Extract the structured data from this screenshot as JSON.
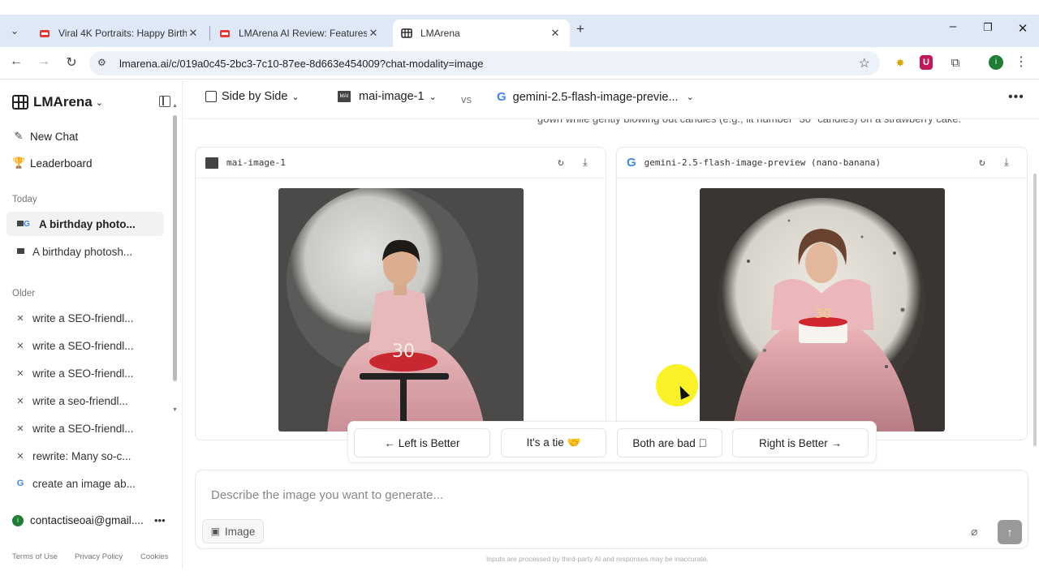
{
  "browser": {
    "tabs": [
      {
        "title": "Viral 4K Portraits: Happy Birthd",
        "favicon_color": "#e53935"
      },
      {
        "title": "LMArena AI Review: Features, P",
        "favicon_color": "#e53935"
      },
      {
        "title": "LMArena",
        "favicon_color": "#222222"
      }
    ],
    "tab_close": "✕",
    "new_tab": "+",
    "url": "lmarena.ai/c/019a0c45-2bc3-7c10-87ee-8d663e454009?chat-modality=image",
    "profile_initial": "i"
  },
  "sidebar": {
    "brand": "LMArena",
    "nav": [
      {
        "label": "New Chat",
        "icon": "edit-icon"
      },
      {
        "label": "Leaderboard",
        "icon": "trophy-icon"
      }
    ],
    "today_label": "Today",
    "today": [
      {
        "label": "A birthday photo...",
        "icon": "model-pair-icon",
        "active": true
      },
      {
        "label": "A birthday photosh...",
        "icon": "mai-icon",
        "active": false
      }
    ],
    "older_label": "Older",
    "older": [
      {
        "label": "write a SEO-friendl...",
        "icon": "x-icon"
      },
      {
        "label": "write a SEO-friendl...",
        "icon": "x-icon"
      },
      {
        "label": "write a SEO-friendl...",
        "icon": "x-icon"
      },
      {
        "label": "write a seo-friendl...",
        "icon": "x-icon"
      },
      {
        "label": "write a SEO-friendl...",
        "icon": "x-icon"
      },
      {
        "label": "rewrite: Many so-c...",
        "icon": "x-icon"
      },
      {
        "label": "create an image ab...",
        "icon": "google-icon"
      }
    ],
    "account": {
      "email": "contactiseoai@gmail....",
      "initial": "i"
    },
    "footer": [
      "Terms of Use",
      "Privacy Policy",
      "Cookies"
    ]
  },
  "header": {
    "mode": "Side by Side",
    "model_left": "mai-image-1",
    "vs": "vs",
    "model_right": "gemini-2.5-flash-image-previe..."
  },
  "prompt_text": "gown while gently blowing out candles (e.g., lit number \"30\" candles) on a strawberry cake.",
  "panels": {
    "left": {
      "model": "mai-image-1",
      "logo_text": "MAI"
    },
    "right": {
      "model": "gemini-2.5-flash-image-preview (nano-banana)",
      "logo_text": "G"
    }
  },
  "cake_number": "30",
  "votes": {
    "left": "← Left is Better",
    "tie": "It's a tie 🤝",
    "both_bad": "Both are bad ⃠",
    "right": "Right is Better →"
  },
  "composer": {
    "placeholder": "Describe the image you want to generate...",
    "image_button": "Image"
  },
  "disclaimer": "Inputs are processed by third-party AI and responses may be inaccurate."
}
